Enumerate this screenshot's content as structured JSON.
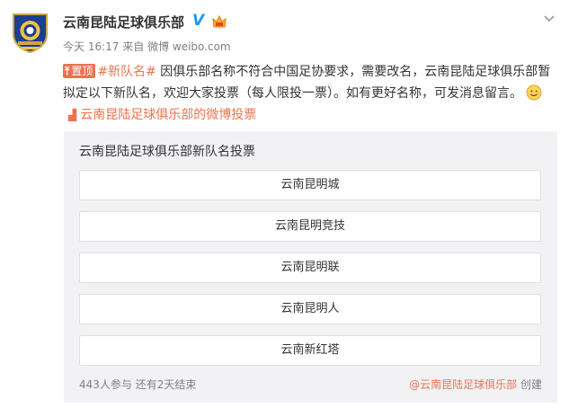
{
  "account": {
    "name": "云南昆陆足球俱乐部",
    "verified_mark": "V",
    "avatar_icon": "club-crest-icon",
    "vip_icon": "vip-crown-icon"
  },
  "meta": {
    "time": "今天 16:17",
    "source_prefix": "来自",
    "source": "微博 weibo.com"
  },
  "post": {
    "pin_label": "置顶",
    "hashtag": "#新队名#",
    "text_main": "因俱乐部名称不符合中国足协要求，需要改名，云南昆陆足球俱乐部暂拟定以下新队名，欢迎大家投票（每人限投一票）。如有更好名称，可发消息留言。",
    "link_text": "云南昆陆足球俱乐部的微博投票"
  },
  "vote": {
    "title": "云南昆陆足球俱乐部新队名投票",
    "options": [
      "云南昆明城",
      "云南昆明竞技",
      "云南昆明联",
      "云南昆明人",
      "云南新红塔"
    ],
    "participants": "443人参与",
    "ends": "还有2天结束",
    "creator": "@云南昆陆足球俱乐部",
    "created_label": "创建"
  },
  "colors": {
    "accent": "#eb7350",
    "verified": "#1a9bf1",
    "card_bg": "#f2f2f5"
  }
}
